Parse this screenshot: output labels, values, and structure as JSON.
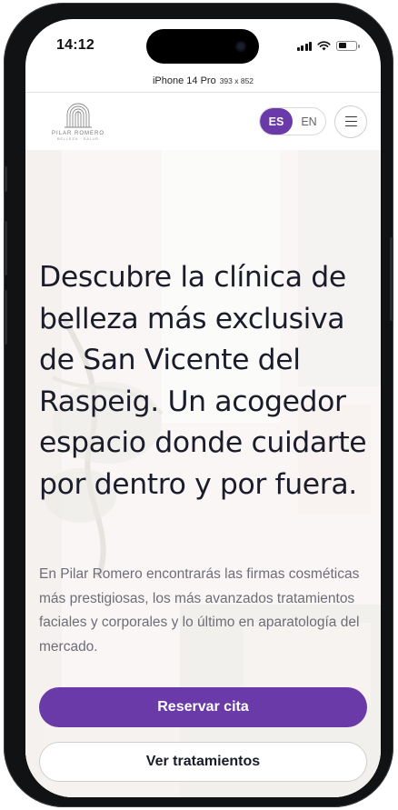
{
  "status_bar": {
    "time": "14:12",
    "signal_icon": "cellular-signal-icon",
    "wifi_icon": "wifi-icon",
    "battery_icon": "battery-icon",
    "battery_level": 0.45
  },
  "device": {
    "name": "iPhone 14 Pro",
    "dimensions": "393 x 852"
  },
  "header": {
    "logo_icon": "pilar-romero-logo",
    "logo_text": "PILAR ROMERO",
    "logo_subtext": "BELLEZA · SALUD",
    "languages": [
      {
        "code": "ES",
        "active": true
      },
      {
        "code": "EN",
        "active": false
      }
    ],
    "menu_icon": "hamburger-menu-icon"
  },
  "hero": {
    "headline": "Descubre la clínica de belleza más exclusiva de San Vicente del Raspeig. Un acogedor espacio donde cuidarte por dentro y por fuera.",
    "description": "En Pilar Romero encontrarás las firmas cosméticas más prestigiosas, los más avanzados tratamientos faciales y corporales y lo último en aparatología del mercado.",
    "primary_button": "Reservar cita",
    "secondary_button": "Ver tratamientos"
  },
  "colors": {
    "accent": "#6a3aa8",
    "headline_text": "#1b1c2a",
    "body_text": "#6e6e78"
  }
}
